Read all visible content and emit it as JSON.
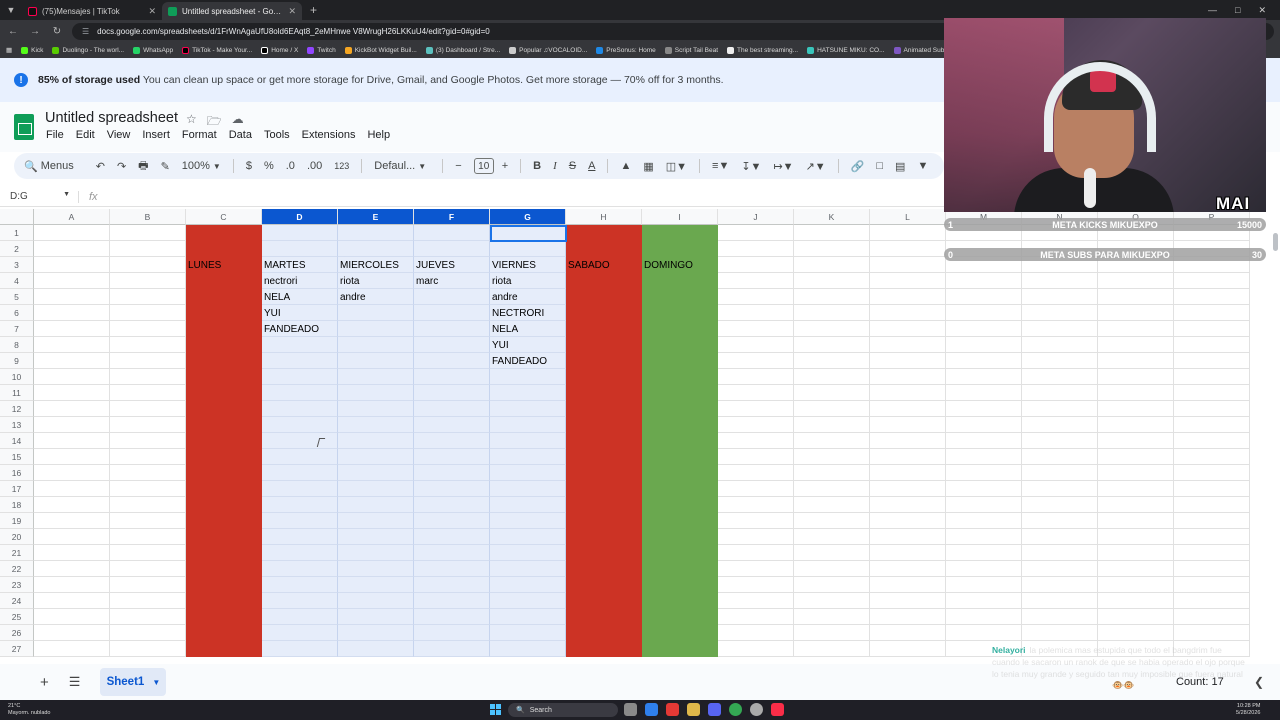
{
  "colors": {
    "red": "#cc3325",
    "green": "#6aa84f",
    "selected_col": "#e6edfa",
    "accent": "#0b57d0"
  },
  "browser": {
    "tabs": [
      {
        "title": "(75)Mensajes | TikTok",
        "icon": "tiktok-icon"
      },
      {
        "title": "Untitled spreadsheet - Google",
        "icon": "sheets-icon"
      }
    ],
    "url": "docs.google.com/spreadsheets/d/1FrWnAgaUfU8old6EAqt8_2eMHnwe V8WrugH26LKKuU4/edit?gid=0#gid=0",
    "bookmarks": [
      "Kick",
      "Duolingo - The worl...",
      "WhatsApp",
      "TikTok - Make Your...",
      "Home / X",
      "Twitch",
      "KickBot Widget Buil...",
      "(3) Dashboard / Stre...",
      "Popular ♫VOCALOID...",
      "PreSonus: Home",
      "Script Tail Beat",
      "The best streaming...",
      "HATSUNE MIKU: CO...",
      "Animated Subtitles..."
    ]
  },
  "banner": {
    "bold": "85% of storage used",
    "text": "You can clean up space or get more storage for Drive, Gmail, and Google Photos. Get more storage — 70% off for 3 months."
  },
  "doc": {
    "title": "Untitled spreadsheet",
    "menu": [
      "File",
      "Edit",
      "View",
      "Insert",
      "Format",
      "Data",
      "Tools",
      "Extensions",
      "Help"
    ]
  },
  "toolbar": {
    "search": "Menus",
    "zoom": "100%",
    "currency": "$",
    "percent": "%",
    "dec_decrease": ".0",
    "dec_increase": ".00",
    "number_format": "123",
    "font": "Defaul...",
    "font_size": "10"
  },
  "formula": {
    "namebox": "D:G",
    "fx": "fx",
    "value": ""
  },
  "columns": [
    "A",
    "B",
    "C",
    "D",
    "E",
    "F",
    "G",
    "H",
    "I",
    "J",
    "K",
    "L",
    "M",
    "N",
    "O",
    "P"
  ],
  "rows": [
    "1",
    "2",
    "3",
    "4",
    "5",
    "6",
    "7",
    "8",
    "9",
    "10",
    "11",
    "12",
    "13",
    "14",
    "15",
    "16",
    "17",
    "18",
    "19",
    "20",
    "21",
    "22",
    "23",
    "24",
    "25",
    "26",
    "27"
  ],
  "cells": {
    "C3": "LUNES",
    "D3": "MARTES",
    "E3": "MIERCOLES",
    "F3": "JUEVES",
    "G3": "VIERNES",
    "H3": "SABADO",
    "I3": "DOMINGO",
    "D4": "nectrori",
    "E4": "riota",
    "F4": "marc",
    "G4": "riota",
    "D5": "NELA",
    "E5": "andre",
    "G5": "andre",
    "D6": "YUI",
    "G6": "NECTRORI",
    "D7": "FANDEADO",
    "G7": "NELA",
    "G8": "YUI",
    "G9": "FANDEADO"
  },
  "sheets": {
    "add": "+",
    "list": "☰",
    "active": "Sheet1",
    "count": "Count: 17"
  },
  "overlay": {
    "goal1": {
      "left": "1",
      "label": "META KICKS MIKUEXPO",
      "right": "15000"
    },
    "goal2": {
      "left": "0",
      "label": "META SUBS PARA MIKUEXPO",
      "right": "30"
    },
    "brand": "MAI",
    "chat_user": "Nelayori",
    "chat_text": "la polemica mas estupida que todo el bangdrim fue cuando le sacaron un ranok de que se habia operado el ojo porque lo tenia muy grande y seguido tan muy imposible que fuera natural"
  },
  "taskbar": {
    "weather_temp": "21°C",
    "weather_desc": "Mayorm. nublado",
    "search": "Search",
    "time": "10:28 PM",
    "date": "5/28/2026"
  }
}
